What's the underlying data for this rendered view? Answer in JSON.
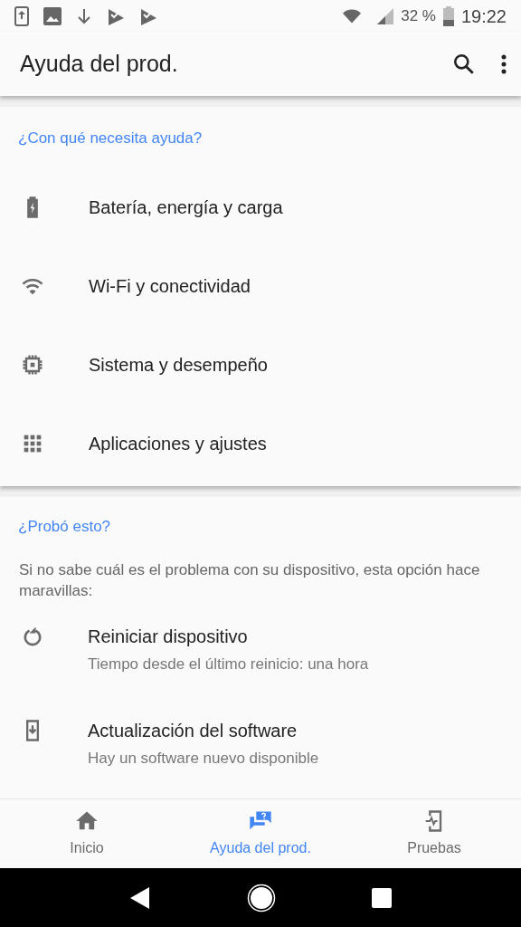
{
  "status_bar": {
    "battery": "32 %",
    "time": "19:22"
  },
  "app_bar": {
    "title": "Ayuda del prod."
  },
  "help_section": {
    "heading": "¿Con qué necesita ayuda?",
    "items": [
      {
        "kind": "battery",
        "label": "Batería, energía y carga"
      },
      {
        "kind": "wifi",
        "label": "Wi-Fi y conectividad"
      },
      {
        "kind": "chip",
        "label": "Sistema y desempeño"
      },
      {
        "kind": "grid",
        "label": "Aplicaciones y ajustes"
      }
    ]
  },
  "tried_section": {
    "heading": "¿Probó esto?",
    "description": "Si no sabe cuál es el problema con su dispositivo, esta opción hace maravillas:",
    "items": [
      {
        "kind": "restart",
        "title": "Reiniciar dispositivo",
        "subtitle": "Tiempo desde el último reinicio: una hora"
      },
      {
        "kind": "update",
        "title": "Actualización del software",
        "subtitle": "Hay un software nuevo disponible"
      }
    ]
  },
  "bottom_nav": [
    {
      "kind": "home",
      "label": "Inicio",
      "selected": false
    },
    {
      "kind": "help",
      "label": "Ayuda del prod.",
      "selected": true
    },
    {
      "kind": "tests",
      "label": "Pruebas",
      "selected": false
    }
  ]
}
